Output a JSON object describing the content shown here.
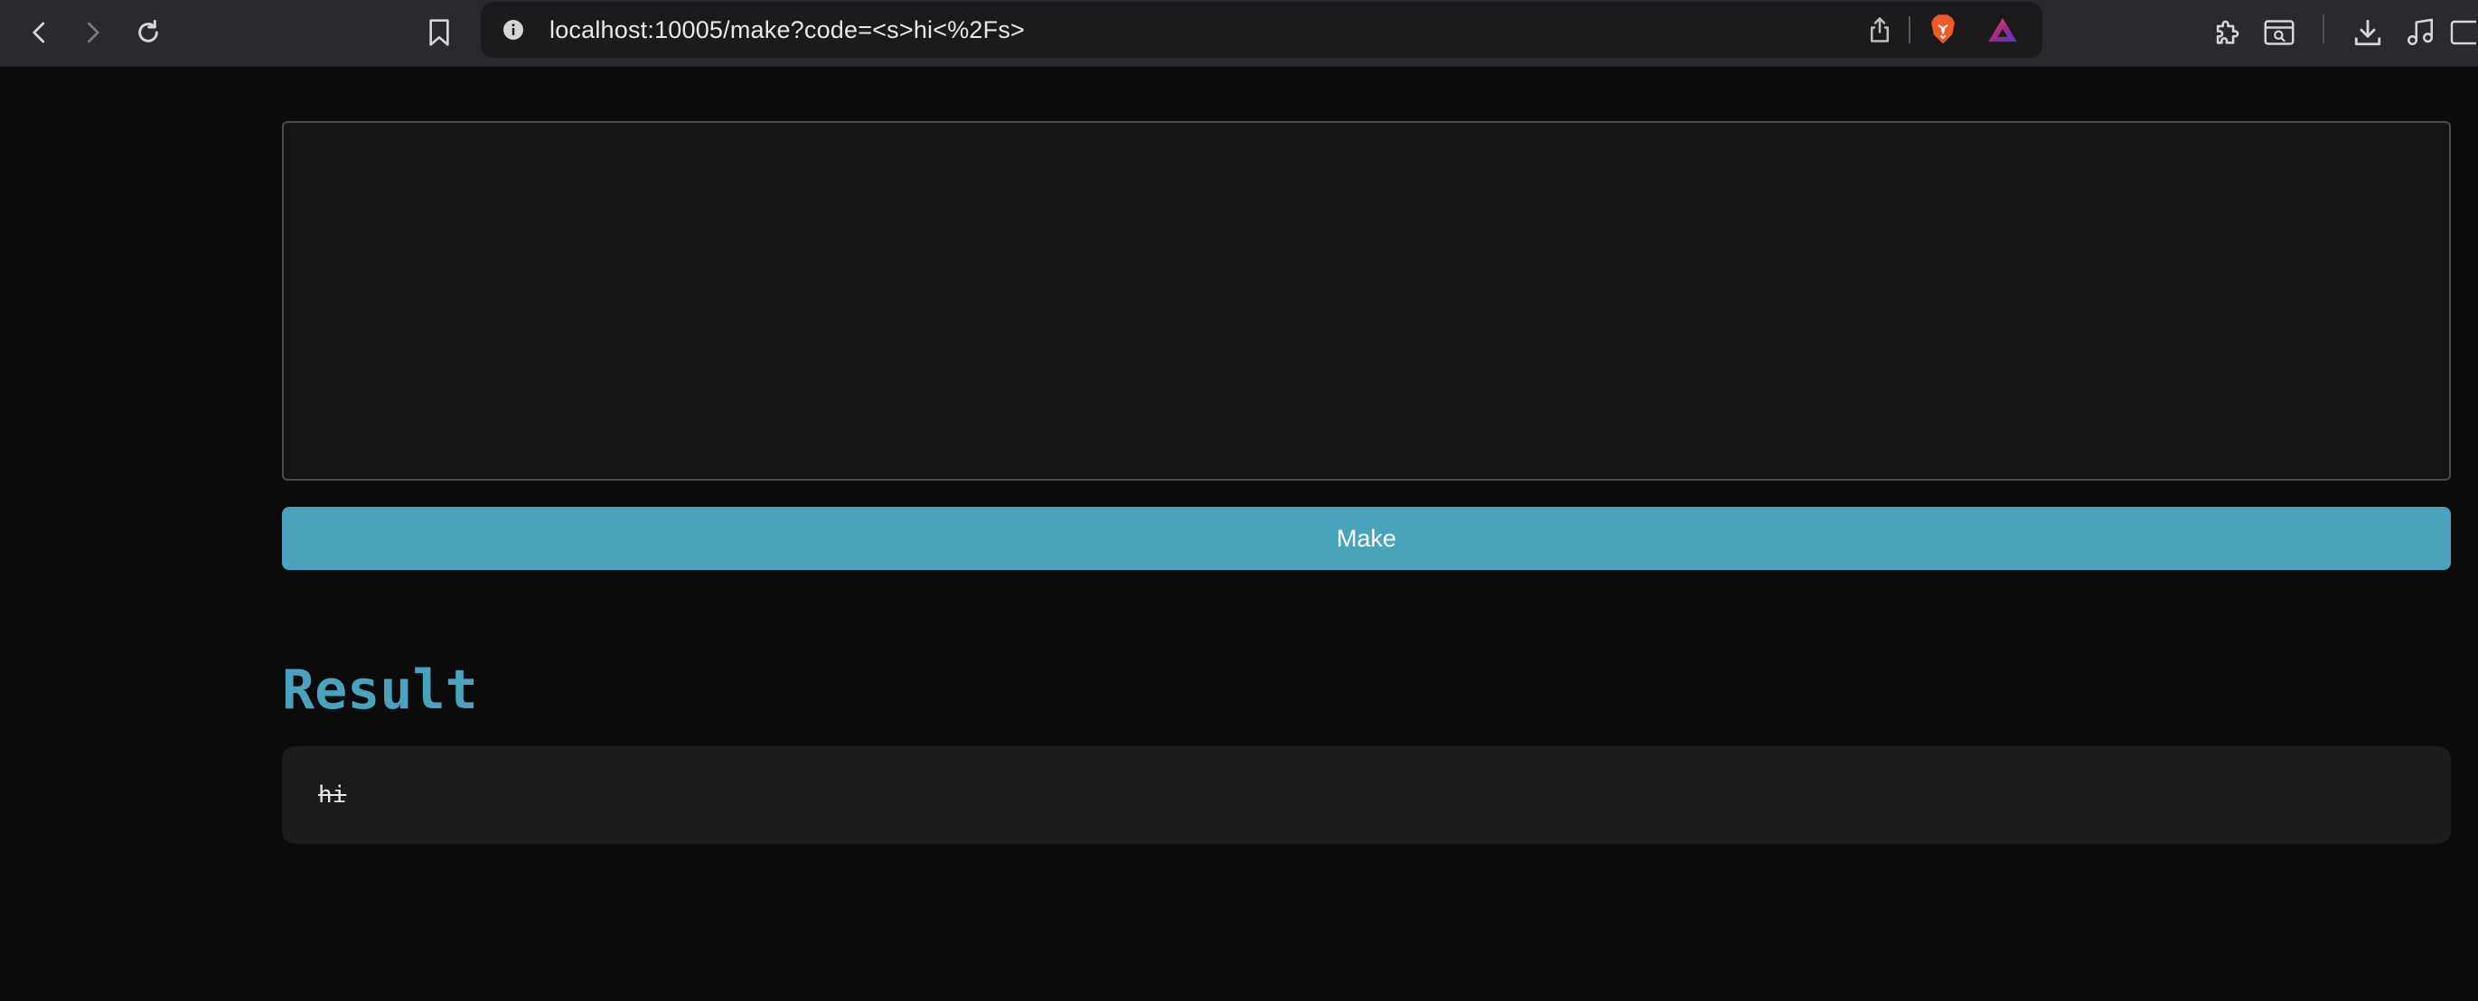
{
  "browser": {
    "url": "localhost:10005/make?code=<s>hi<%2Fs>",
    "icons": {
      "back": "chevron-left-icon",
      "forward": "chevron-right-icon",
      "reload": "reload-icon",
      "bookmark": "bookmark-icon",
      "site_info": "info-icon",
      "share": "share-icon",
      "brave_shields": "brave-lion-icon",
      "brave_rewards": "triangle-rewards-icon",
      "extensions": "puzzle-icon",
      "reader": "reader-mode-icon",
      "downloads": "download-icon",
      "media": "music-note-icon",
      "sidebar": "sidebar-icon"
    },
    "colors": {
      "toolbar_bg": "#2a2a2e",
      "address_bg": "#1b1b1d",
      "brave_orange": "#f15a24",
      "rewards_purple": "#a3278f"
    }
  },
  "editor": {
    "value": "",
    "placeholder": ""
  },
  "make_button": {
    "label": "Make"
  },
  "result": {
    "heading": "Result",
    "output_text": "hi"
  },
  "theme": {
    "page_bg": "#0b0b0b",
    "accent": "#4aa3bd",
    "textarea_bg": "#151515",
    "result_bg": "#1b1b1b"
  }
}
